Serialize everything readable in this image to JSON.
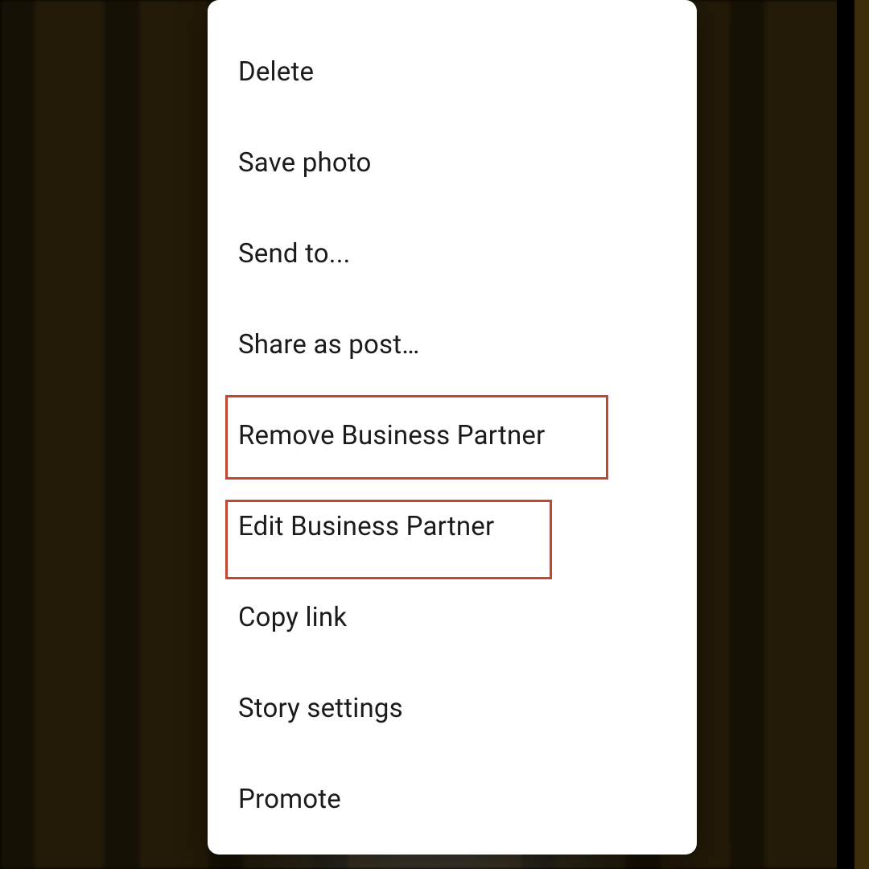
{
  "colors": {
    "highlight": "#c24730",
    "sheet_bg": "#ffffff",
    "text": "#1b1b1b"
  },
  "menu": {
    "items": [
      {
        "id": "delete",
        "label": "Delete",
        "highlighted": false
      },
      {
        "id": "save-photo",
        "label": "Save photo",
        "highlighted": false
      },
      {
        "id": "send-to",
        "label": "Send to...",
        "highlighted": false
      },
      {
        "id": "share-as-post",
        "label": "Share as post…",
        "highlighted": false
      },
      {
        "id": "remove-partner",
        "label": "Remove Business Partner",
        "highlighted": true
      },
      {
        "id": "edit-partner",
        "label": "Edit Business Partner",
        "highlighted": true
      },
      {
        "id": "copy-link",
        "label": "Copy link",
        "highlighted": false
      },
      {
        "id": "story-settings",
        "label": "Story settings",
        "highlighted": false
      },
      {
        "id": "promote",
        "label": "Promote",
        "highlighted": false
      }
    ]
  }
}
